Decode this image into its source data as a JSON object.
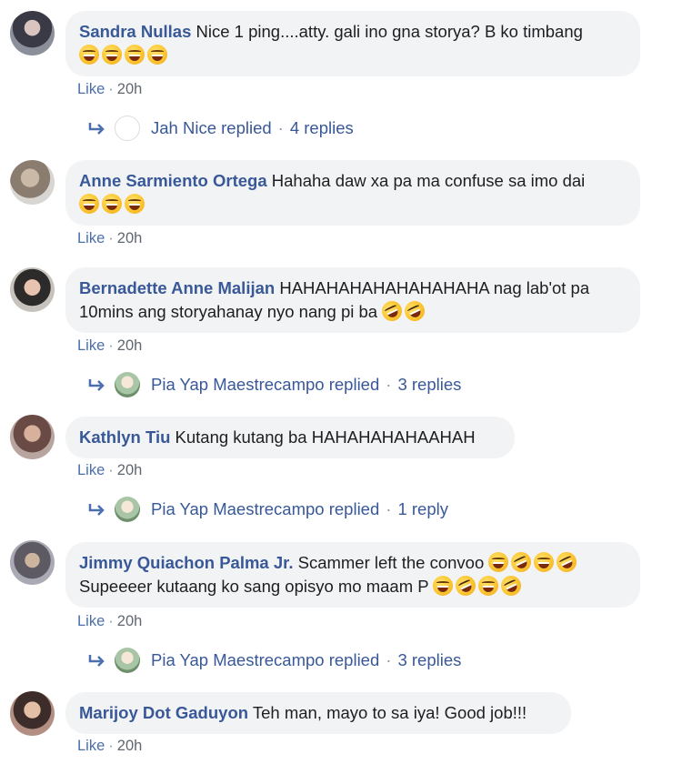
{
  "comments": [
    {
      "author": "Sandra Nullas",
      "text": "Nice 1 ping....atty. gali ino gna storya? B ko timbang",
      "emojis_line1": [],
      "emojis_line2": [
        "laughing-tears",
        "laughing-tears",
        "laughing-tears",
        "laughing-tears"
      ],
      "like": "Like",
      "time": "20h",
      "replies": {
        "name": "Jah Nice replied",
        "count": "4 replies"
      }
    },
    {
      "author": "Anne Sarmiento Ortega",
      "text": "Hahaha daw xa pa ma confuse sa imo dai",
      "emojis_line2": [
        "laughing",
        "laughing",
        "laughing"
      ],
      "like": "Like",
      "time": "20h"
    },
    {
      "author": "Bernadette Anne Malijan",
      "text": "HAHAHAHAHAHAHAHAHA nag lab'ot pa",
      "text_line2": "10mins ang storyahanay nyo nang pi ba",
      "emojis_line2": [
        "rofl",
        "rofl"
      ],
      "like": "Like",
      "time": "20h",
      "replies": {
        "name": "Pia Yap Maestrecampo replied",
        "count": "3 replies"
      }
    },
    {
      "author": "Kathlyn Tiu",
      "text": "Kutang kutang ba HAHAHAHAHAAHAH",
      "like": "Like",
      "time": "20h",
      "replies": {
        "name": "Pia Yap Maestrecampo replied",
        "count": "1 reply"
      }
    },
    {
      "author": "Jimmy Quiachon Palma Jr.",
      "text": "Scammer left the convoo",
      "emojis_line1": [
        "laughing-tears",
        "rofl",
        "laughing-tears",
        "rofl"
      ],
      "text_line2": "Supeeeer kutaang ko sang opisyo mo maam P",
      "emojis_line2": [
        "laughing-tears",
        "rofl",
        "laughing-tears",
        "rofl"
      ],
      "like": "Like",
      "time": "20h",
      "replies": {
        "name": "Pia Yap Maestrecampo replied",
        "count": "3 replies"
      }
    },
    {
      "author": "Marijoy Dot Gaduyon",
      "text": "Teh man, mayo to sa iya! Good job!!!",
      "like": "Like",
      "time": "20h"
    }
  ],
  "separator": "·",
  "colors": {
    "author": "#385898",
    "bubble": "#f2f3f5",
    "meta": "#606770",
    "link": "#4b6eaf"
  },
  "icons": {
    "reply": "reply-arrow-icon"
  }
}
